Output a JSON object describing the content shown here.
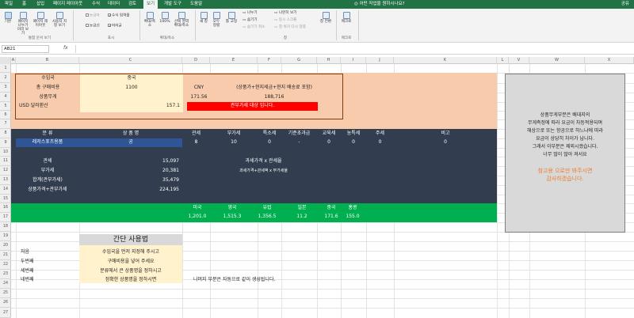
{
  "tabs": {
    "items": [
      "파일",
      "홈",
      "삽입",
      "페이지 레이아웃",
      "수식",
      "데이터",
      "검토",
      "보기",
      "개발 도구",
      "도움말"
    ],
    "active": "보기",
    "tell_me": "어떤 작업을 원하시나요?",
    "share": "공유"
  },
  "ribbon": {
    "workbook_views": {
      "normal": "기본",
      "page_break": "페이지 나누기 미리 보기",
      "page_layout": "페이지 레이아웃",
      "custom_views": "사용자 지정 보기",
      "group": "통합 문서 보기"
    },
    "show": {
      "ruler": "눈금자",
      "formula_bar": "수식 입력줄",
      "gridlines": "눈금선",
      "headings": "머리글",
      "group": "표시"
    },
    "zoom": {
      "zoom": "확대/축소",
      "hundred": "100%",
      "to_selection": "선택 영역 확대/축소",
      "group": "확대/축소"
    },
    "window": {
      "new_window": "새 창",
      "arrange_all": "모두 정렬",
      "freeze_panes": "틀 고정",
      "split": "나누기",
      "hide": "숨기기",
      "unhide": "숨기기 취소",
      "side_by_side": "나란히 보기",
      "sync_scroll": "동시 스크롤",
      "reset_position": "창 위치 다시 정렬",
      "switch_windows": "창 전환",
      "group": "창"
    },
    "macros": {
      "macros": "매크로",
      "group": "매크로"
    }
  },
  "formula_bar": {
    "name_box": "AB21",
    "fx": "fx",
    "formula": ""
  },
  "grid": {
    "columns": [
      "A",
      "B",
      "C",
      "D",
      "E",
      "F",
      "G",
      "H",
      "I",
      "J",
      "K",
      "L",
      "V",
      "W",
      "X"
    ],
    "rows": [
      "1",
      "2",
      "3",
      "4",
      "5",
      "6",
      "7",
      "8",
      "9",
      "10",
      "11",
      "12",
      "13",
      "14",
      "15",
      "16",
      "17",
      "18",
      "19",
      "20",
      "21",
      "22",
      "23",
      "24",
      "25",
      "26",
      "27"
    ]
  },
  "input_box": {
    "import_country_label": "수입국",
    "import_country_value": "중국",
    "total_cost_label": "총 구매비용",
    "total_cost_value": "1100",
    "currency": "CNY",
    "formula_note": "(상품가+현지세금+현지 배송료 포함)",
    "product_weight_label": "상품무게",
    "krw_value_1": "171.56",
    "krw_value_2": "188,716",
    "usd_rate_label": "USD 달러환산",
    "usd_rate_value": "157.1",
    "customs_warning": "관부가세 대상 입니다."
  },
  "tax_table": {
    "headers": [
      "분 류",
      "상 품 명",
      "관세",
      "부가세",
      "특소세",
      "기준초과금",
      "교육세",
      "농특세",
      "주세",
      "비고"
    ],
    "row": [
      "레저스포츠용품",
      "공",
      "8",
      "10",
      "0",
      "-",
      "0",
      "0",
      "0",
      "0"
    ],
    "summary_labels": [
      "관세",
      "부가세",
      "합계(관부가세)",
      "상품가격+관부가세"
    ],
    "summary_values": [
      "15,097",
      "20,381",
      "35,479",
      "224,195"
    ],
    "formula_1": "과세가격 x 관세율",
    "formula_2": "과세가격+관세액 x 부가세율"
  },
  "exchange_rates": {
    "countries": [
      "미국",
      "영국",
      "유럽",
      "일본",
      "중국",
      "홍콩"
    ],
    "rates": [
      "1,201.0",
      "1,515.3",
      "1,356.5",
      "11.2",
      "171.6",
      "155.0"
    ]
  },
  "usage": {
    "title": "간단 사용법",
    "steps": [
      {
        "label": "처음",
        "text": "수입국을 먼저 지정해 주시고"
      },
      {
        "label": "두번째",
        "text": "구매비용을 넣어 주세요"
      },
      {
        "label": "세번째",
        "text": "분류에서 큰 상품명을 정하시고"
      },
      {
        "label": "네번째",
        "text": "정확한 상품명을 정하시면"
      }
    ],
    "auto_note": "나머지 부분은 자동으로 같이 생성됩니다."
  },
  "side_note": {
    "lines": [
      "상품무게부분은 배대지의",
      "무게측정에 따라 요금이 차등적용되며",
      "해상으로 또는 항공으로 하느냐에 따라",
      "요금이 상당히 차이가 납니다.",
      "그래서 이부분은 제외시켰습니다.",
      "너무 많이 많아 져서요"
    ],
    "thanks": [
      "참고용 으로만 봐주시면",
      "감사하겠습니다."
    ]
  },
  "colors": {
    "excel_green": "#217346",
    "peach": "#f8cbad",
    "dark_slate": "#323e4f",
    "blue_highlight": "#2f5597",
    "green_band": "#00b050",
    "red_warning": "#ff0000",
    "yellow_input": "#fff2cc",
    "side_gray": "#d9d9d9",
    "orange_text": "#ed7d31"
  }
}
